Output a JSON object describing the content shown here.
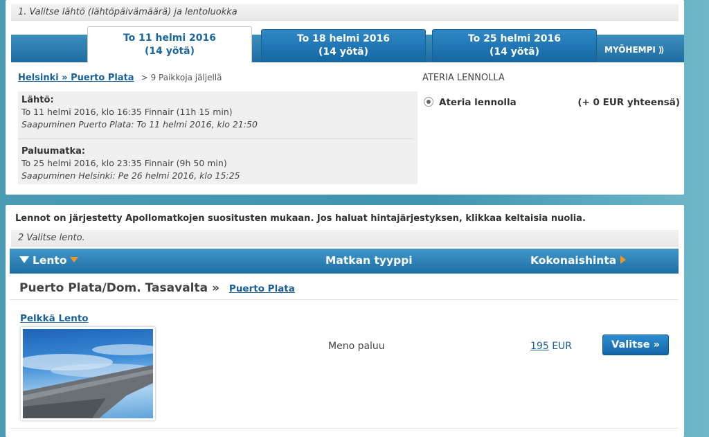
{
  "step1": {
    "label": "1. Valitse lähtö (lähtöpäivämäärä) ja lentoluokka"
  },
  "date_tabs": [
    {
      "date": "To 11 helmi 2016",
      "nights": "(14 yötä)"
    },
    {
      "date": "To 18 helmi 2016",
      "nights": "(14 yötä)"
    },
    {
      "date": "To 25 helmi 2016",
      "nights": "(14 yötä)"
    }
  ],
  "later_label": "MYÖHEMPI ⟫",
  "route": {
    "link": "Helsinki » Puerto Plata",
    "seats": "> 9 Paikkoja jäljellä"
  },
  "outbound": {
    "title": "Lähtö:",
    "line": "To 11 helmi 2016, klo 16:35 Finnair (11h 15 min)",
    "arrival": "Saapuminen Puerto Plata: To 11 helmi 2016, klo 21:50"
  },
  "return": {
    "title": "Paluumatka:",
    "line": "To 25 helmi 2016, klo 23:35 Finnair (9h 50 min)",
    "arrival": "Saapuminen Helsinki: Pe 26 helmi 2016, klo 15:25"
  },
  "meal": {
    "heading": "ATERIA LENNOLLA",
    "option": "Ateria lennolla",
    "price": "(+ 0 EUR yhteensä)"
  },
  "info_text": "Lennot on järjestetty Apollomatkojen suositusten mukaan. Jos haluat hintajärjestyksen, klikkaa keltaisia nuolia.",
  "step2": {
    "label": "2 Valitse lento."
  },
  "list_header": {
    "flight": "Lento",
    "trip_type": "Matkan tyyppi",
    "total_price": "Kokonaishinta"
  },
  "destination": {
    "title": "Puerto Plata/Dom. Tasavalta »",
    "link": "Puerto Plata"
  },
  "offer": {
    "name": "Pelkkä Lento",
    "trip_type": "Meno paluu",
    "price": "195",
    "currency": "EUR",
    "button": "Valitse »"
  }
}
